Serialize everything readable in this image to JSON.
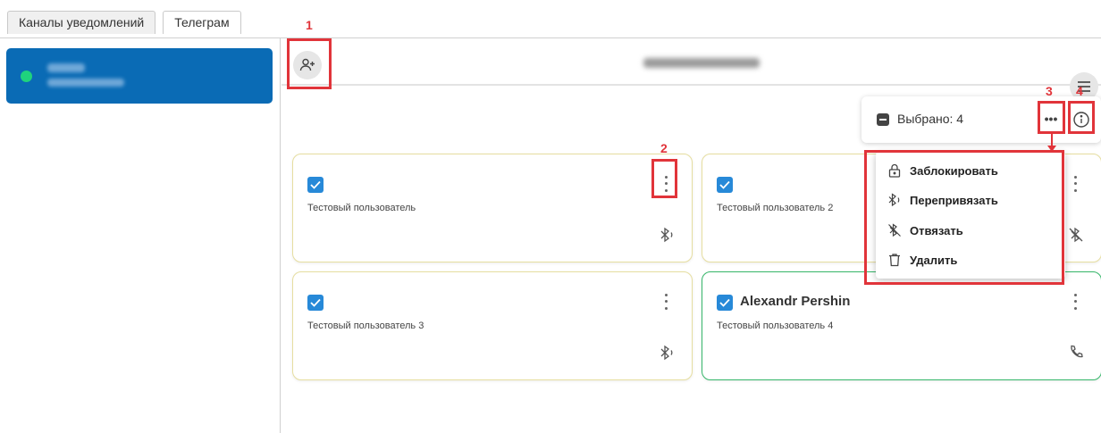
{
  "tabs": [
    {
      "label": "Каналы уведомлений",
      "active": false
    },
    {
      "label": "Телеграм",
      "active": true
    }
  ],
  "sidebar": {
    "channel": {
      "name": "",
      "handle": "",
      "status_color": "#1fd37d",
      "selected_color": "#0a6bb5"
    }
  },
  "header": {
    "title": "",
    "add_user_icon": "person-add-icon",
    "menu_icon": "hamburger-icon"
  },
  "selection": {
    "label": "Выбрано: 4",
    "more_icon": "ellipsis-icon",
    "info_icon": "info-icon"
  },
  "context_menu": {
    "items": [
      {
        "label": "Заблокировать",
        "icon": "lock-icon"
      },
      {
        "label": "Перепривязать",
        "icon": "bluetooth-rebind-icon"
      },
      {
        "label": "Отвязать",
        "icon": "bluetooth-off-icon"
      },
      {
        "label": "Удалить",
        "icon": "trash-icon"
      }
    ]
  },
  "users": [
    {
      "name": "",
      "description": "Тестовый пользователь",
      "checked": true,
      "status_icon": "bluetooth-signal-icon"
    },
    {
      "name": "",
      "description": "Тестовый пользователь 2",
      "checked": true,
      "status_icon": "bluetooth-off-icon"
    },
    {
      "name": "",
      "description": "Тестовый пользователь 3",
      "checked": true,
      "status_icon": "bluetooth-signal-icon"
    },
    {
      "name": "Alexandr Pershin",
      "description": "Тестовый пользователь 4",
      "checked": true,
      "status_icon": "phone-icon"
    }
  ],
  "annotations": [
    "1",
    "2",
    "3",
    "4"
  ],
  "colors": {
    "accent": "#2789d8",
    "annotation": "#e1343a",
    "active_card_border": "#36b66a"
  }
}
